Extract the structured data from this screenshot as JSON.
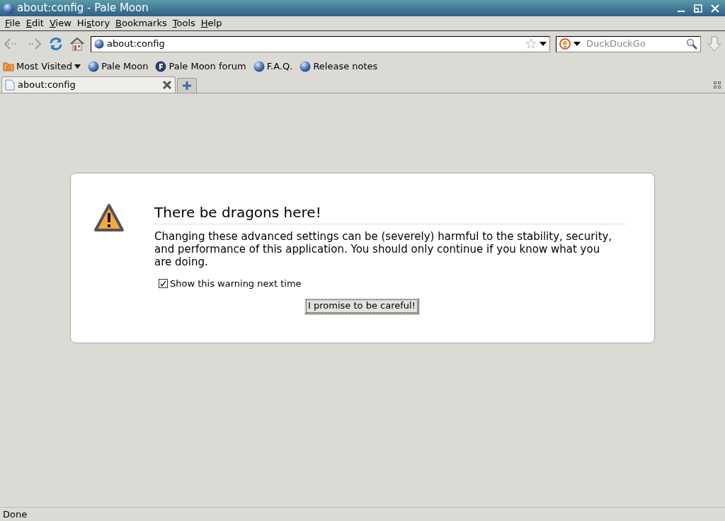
{
  "window": {
    "title": "about:config - Pale Moon"
  },
  "menu": [
    {
      "access_key": "F",
      "after": "ile"
    },
    {
      "access_key": "E",
      "after": "dit"
    },
    {
      "access_key": "V",
      "after": "iew"
    },
    {
      "before": "Hi",
      "access_key": "s",
      "after": "tory"
    },
    {
      "access_key": "B",
      "after": "ookmarks"
    },
    {
      "access_key": "T",
      "after": "ools"
    },
    {
      "access_key": "H",
      "after": "elp"
    }
  ],
  "navigation": {
    "back_disabled": true,
    "forward_disabled": true,
    "address": "about:config",
    "search_engine_placeholder": "DuckDuckGo"
  },
  "bookmarks": [
    {
      "label": "Most Visited",
      "kind": "folder"
    },
    {
      "label": "Pale Moon",
      "kind": "globe"
    },
    {
      "label": "Pale Moon forum",
      "kind": "forum"
    },
    {
      "label": "F.A.Q.",
      "kind": "globe"
    },
    {
      "label": "Release notes",
      "kind": "globe"
    }
  ],
  "tabs": [
    {
      "label": "about:config",
      "selected": true
    }
  ],
  "warning": {
    "title": "There be dragons here!",
    "message": "Changing these advanced settings can be (severely) harmful to the stability, security, and performance of this application. You should only continue if you know what you are doing.",
    "checkbox": {
      "label": "Show this warning next time",
      "checked": true
    },
    "button": "I promise to be careful!"
  },
  "status_bar": "Done"
}
